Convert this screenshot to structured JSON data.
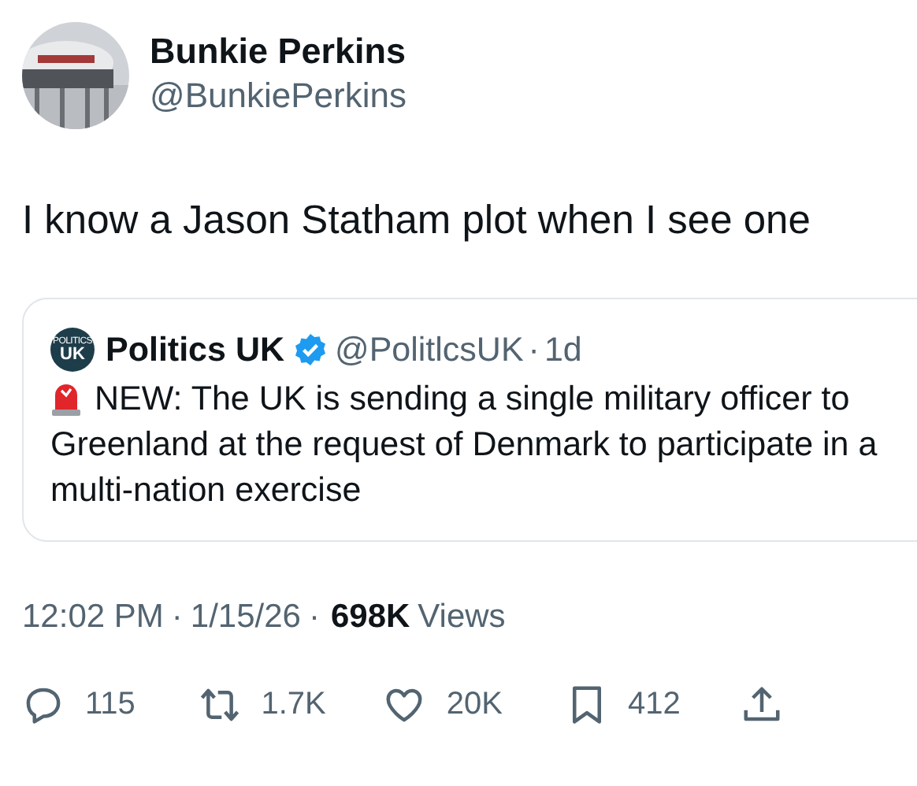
{
  "author": {
    "name": "Bunkie Perkins",
    "handle": "@BunkiePerkins"
  },
  "text": "I know a Jason Statham plot when I see one",
  "quote": {
    "logo_top": "POLITICS",
    "logo_main": "UK",
    "name": "Politics UK",
    "verified": true,
    "handle": "@PolitlcsUK",
    "dot": "·",
    "time": "1d",
    "text": "NEW: The UK is sending a single military officer to Greenland at the request of Denmark to participate in a multi-nation exercise"
  },
  "meta": {
    "time": "12:02 PM",
    "sep1": "·",
    "date": "1/15/26",
    "sep2": "·",
    "views_count": "698K",
    "views_label": "Views"
  },
  "actions": [
    {
      "kind": "reply",
      "count": "115"
    },
    {
      "kind": "repost",
      "count": "1.7K"
    },
    {
      "kind": "like",
      "count": "20K"
    },
    {
      "kind": "bookmark",
      "count": "412"
    },
    {
      "kind": "share"
    }
  ]
}
